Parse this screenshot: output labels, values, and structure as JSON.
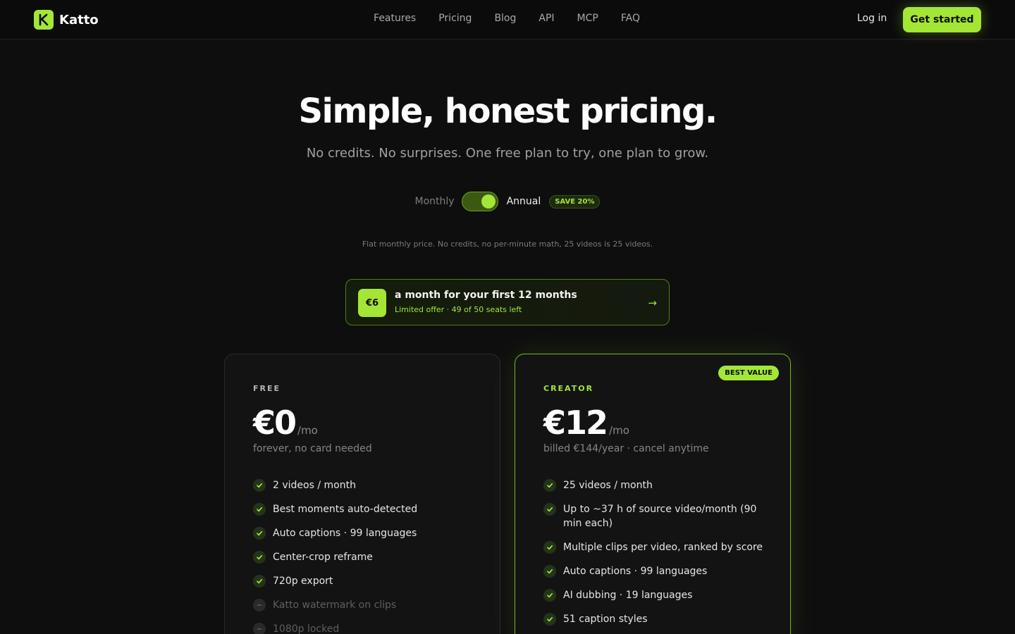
{
  "nav": {
    "brand": "Katto",
    "links": [
      "Features",
      "Pricing",
      "Blog",
      "API",
      "MCP",
      "FAQ"
    ],
    "login": "Log in",
    "cta": "Get started"
  },
  "hero": {
    "title": "Simple, honest pricing.",
    "subtitle": "No credits. No surprises. One free plan to try, one plan to grow."
  },
  "billing": {
    "monthly": "Monthly",
    "annual": "Annual",
    "save_badge": "SAVE 20%",
    "selected": "Annual",
    "note": "Flat monthly price. No credits, no per-minute math, 25 videos is 25 videos."
  },
  "offer": {
    "price": "€6",
    "title": "a month for your first 12 months",
    "subtitle": "Limited offer · 49 of 50 seats left",
    "arrow": "→"
  },
  "plans": {
    "free": {
      "tier": "FREE",
      "price": "€0",
      "per": "/mo",
      "note": "forever, no card needed",
      "features": [
        {
          "text": "2 videos / month",
          "enabled": true
        },
        {
          "text": "Best moments auto-detected",
          "enabled": true
        },
        {
          "text": "Auto captions · 99 languages",
          "enabled": true
        },
        {
          "text": "Center-crop reframe",
          "enabled": true
        },
        {
          "text": "720p export",
          "enabled": true
        },
        {
          "text": "Katto watermark on clips",
          "enabled": false
        },
        {
          "text": "1080p locked",
          "enabled": false
        }
      ]
    },
    "creator": {
      "tier": "CREATOR",
      "badge": "BEST VALUE",
      "price": "€12",
      "per": "/mo",
      "note": "billed €144/year · cancel anytime",
      "features": [
        {
          "text": "25 videos / month",
          "enabled": true
        },
        {
          "text": "Up to ~37 h of source video/month (90 min each)",
          "enabled": true
        },
        {
          "text": "Multiple clips per video, ranked by score",
          "enabled": true
        },
        {
          "text": "Auto captions · 99 languages",
          "enabled": true
        },
        {
          "text": "AI dubbing · 19 languages",
          "enabled": true
        },
        {
          "text": "51 caption styles",
          "enabled": true
        }
      ]
    }
  },
  "colors": {
    "accent": "#a3e635",
    "background": "#0e0e0f",
    "card": "#131314"
  },
  "icons": {
    "check": "check-icon",
    "disabled": "dash-icon",
    "logo": "katto-logo-icon"
  }
}
